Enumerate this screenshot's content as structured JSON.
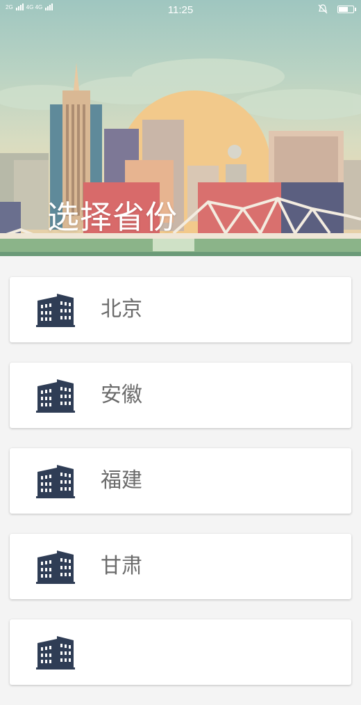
{
  "status_bar": {
    "network_labels": [
      "2G",
      "4G 4G"
    ],
    "time": "11:25",
    "icons": [
      "signal-icon",
      "mute-icon",
      "battery-icon"
    ],
    "battery_level": 0.7
  },
  "header": {
    "title": "选择省份",
    "illustration": "city-skyline-illustration"
  },
  "provinces": {
    "items": [
      {
        "label": "北京",
        "icon": "building-icon"
      },
      {
        "label": "安徽",
        "icon": "building-icon"
      },
      {
        "label": "福建",
        "icon": "building-icon"
      },
      {
        "label": "甘肃",
        "icon": "building-icon"
      },
      {
        "label": "",
        "icon": "building-icon"
      }
    ]
  },
  "colors": {
    "icon": "#2f3d55",
    "label": "#6b6b6b",
    "background": "#f4f4f4"
  }
}
